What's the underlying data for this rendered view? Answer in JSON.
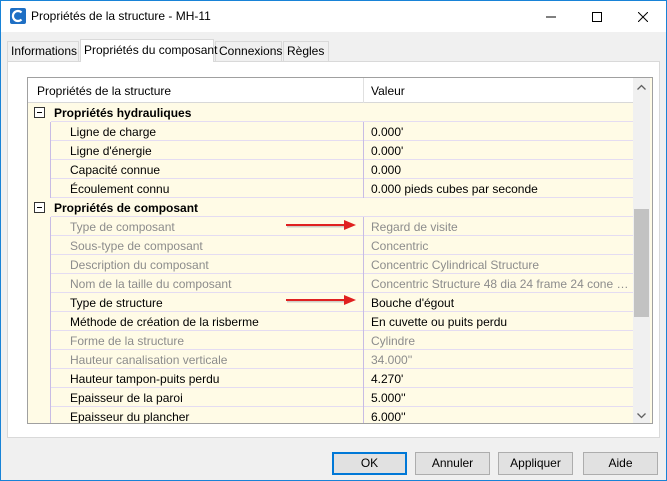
{
  "window": {
    "title": "Propriétés de la structure - MH-11",
    "icon": "civil3d-app-icon"
  },
  "tabs": [
    {
      "label": "Informations",
      "active": false
    },
    {
      "label": "Propriétés du composant",
      "active": true
    },
    {
      "label": "Connexions",
      "active": false
    },
    {
      "label": "Règles",
      "active": false
    }
  ],
  "grid": {
    "col1_header": "Propriétés de la structure",
    "col2_header": "Valeur",
    "rows": [
      {
        "kind": "category",
        "name": "Propriétés hydrauliques",
        "value": ""
      },
      {
        "kind": "prop",
        "name": "Ligne de charge",
        "value": "0.000'",
        "disabled": false
      },
      {
        "kind": "prop",
        "name": "Ligne d'énergie",
        "value": "0.000'",
        "disabled": false
      },
      {
        "kind": "prop",
        "name": "Capacité connue",
        "value": "0.000",
        "disabled": false
      },
      {
        "kind": "prop",
        "name": "Écoulement connu",
        "value": "0.000 pieds cubes par seconde",
        "disabled": false
      },
      {
        "kind": "category",
        "name": "Propriétés de composant",
        "value": ""
      },
      {
        "kind": "prop",
        "name": "Type de composant",
        "value": "Regard de visite",
        "disabled": true
      },
      {
        "kind": "prop",
        "name": "Sous-type de composant",
        "value": "Concentric",
        "disabled": true
      },
      {
        "kind": "prop",
        "name": "Description du composant",
        "value": "Concentric Cylindrical Structure",
        "disabled": true
      },
      {
        "kind": "prop",
        "name": "Nom de la taille du composant",
        "value": "Concentric Structure 48 dia 24 frame 24 cone 5 ...",
        "disabled": true
      },
      {
        "kind": "prop",
        "name": "Type de structure",
        "value": "Bouche d'égout",
        "disabled": false
      },
      {
        "kind": "prop",
        "name": "Méthode de création de la risberme",
        "value": "En cuvette ou puits perdu",
        "disabled": false
      },
      {
        "kind": "prop",
        "name": "Forme de la structure",
        "value": "Cylindre",
        "disabled": true
      },
      {
        "kind": "prop",
        "name": "Hauteur canalisation verticale",
        "value": "34.000''",
        "disabled": true
      },
      {
        "kind": "prop",
        "name": "Hauteur tampon-puits perdu",
        "value": "4.270'",
        "disabled": false
      },
      {
        "kind": "prop",
        "name": "Epaisseur de la paroi",
        "value": "5.000''",
        "disabled": false
      },
      {
        "kind": "prop",
        "name": "Epaisseur du plancher",
        "value": "6.000''",
        "disabled": false
      }
    ]
  },
  "buttons": {
    "ok": "OK",
    "cancel": "Annuler",
    "apply": "Appliquer",
    "help": "Aide"
  },
  "colors": {
    "accent": "#0078d7",
    "grid_bg": "#fffbe6",
    "disabled_text": "#8c8c8c",
    "annotation_arrow": "#e02020"
  }
}
